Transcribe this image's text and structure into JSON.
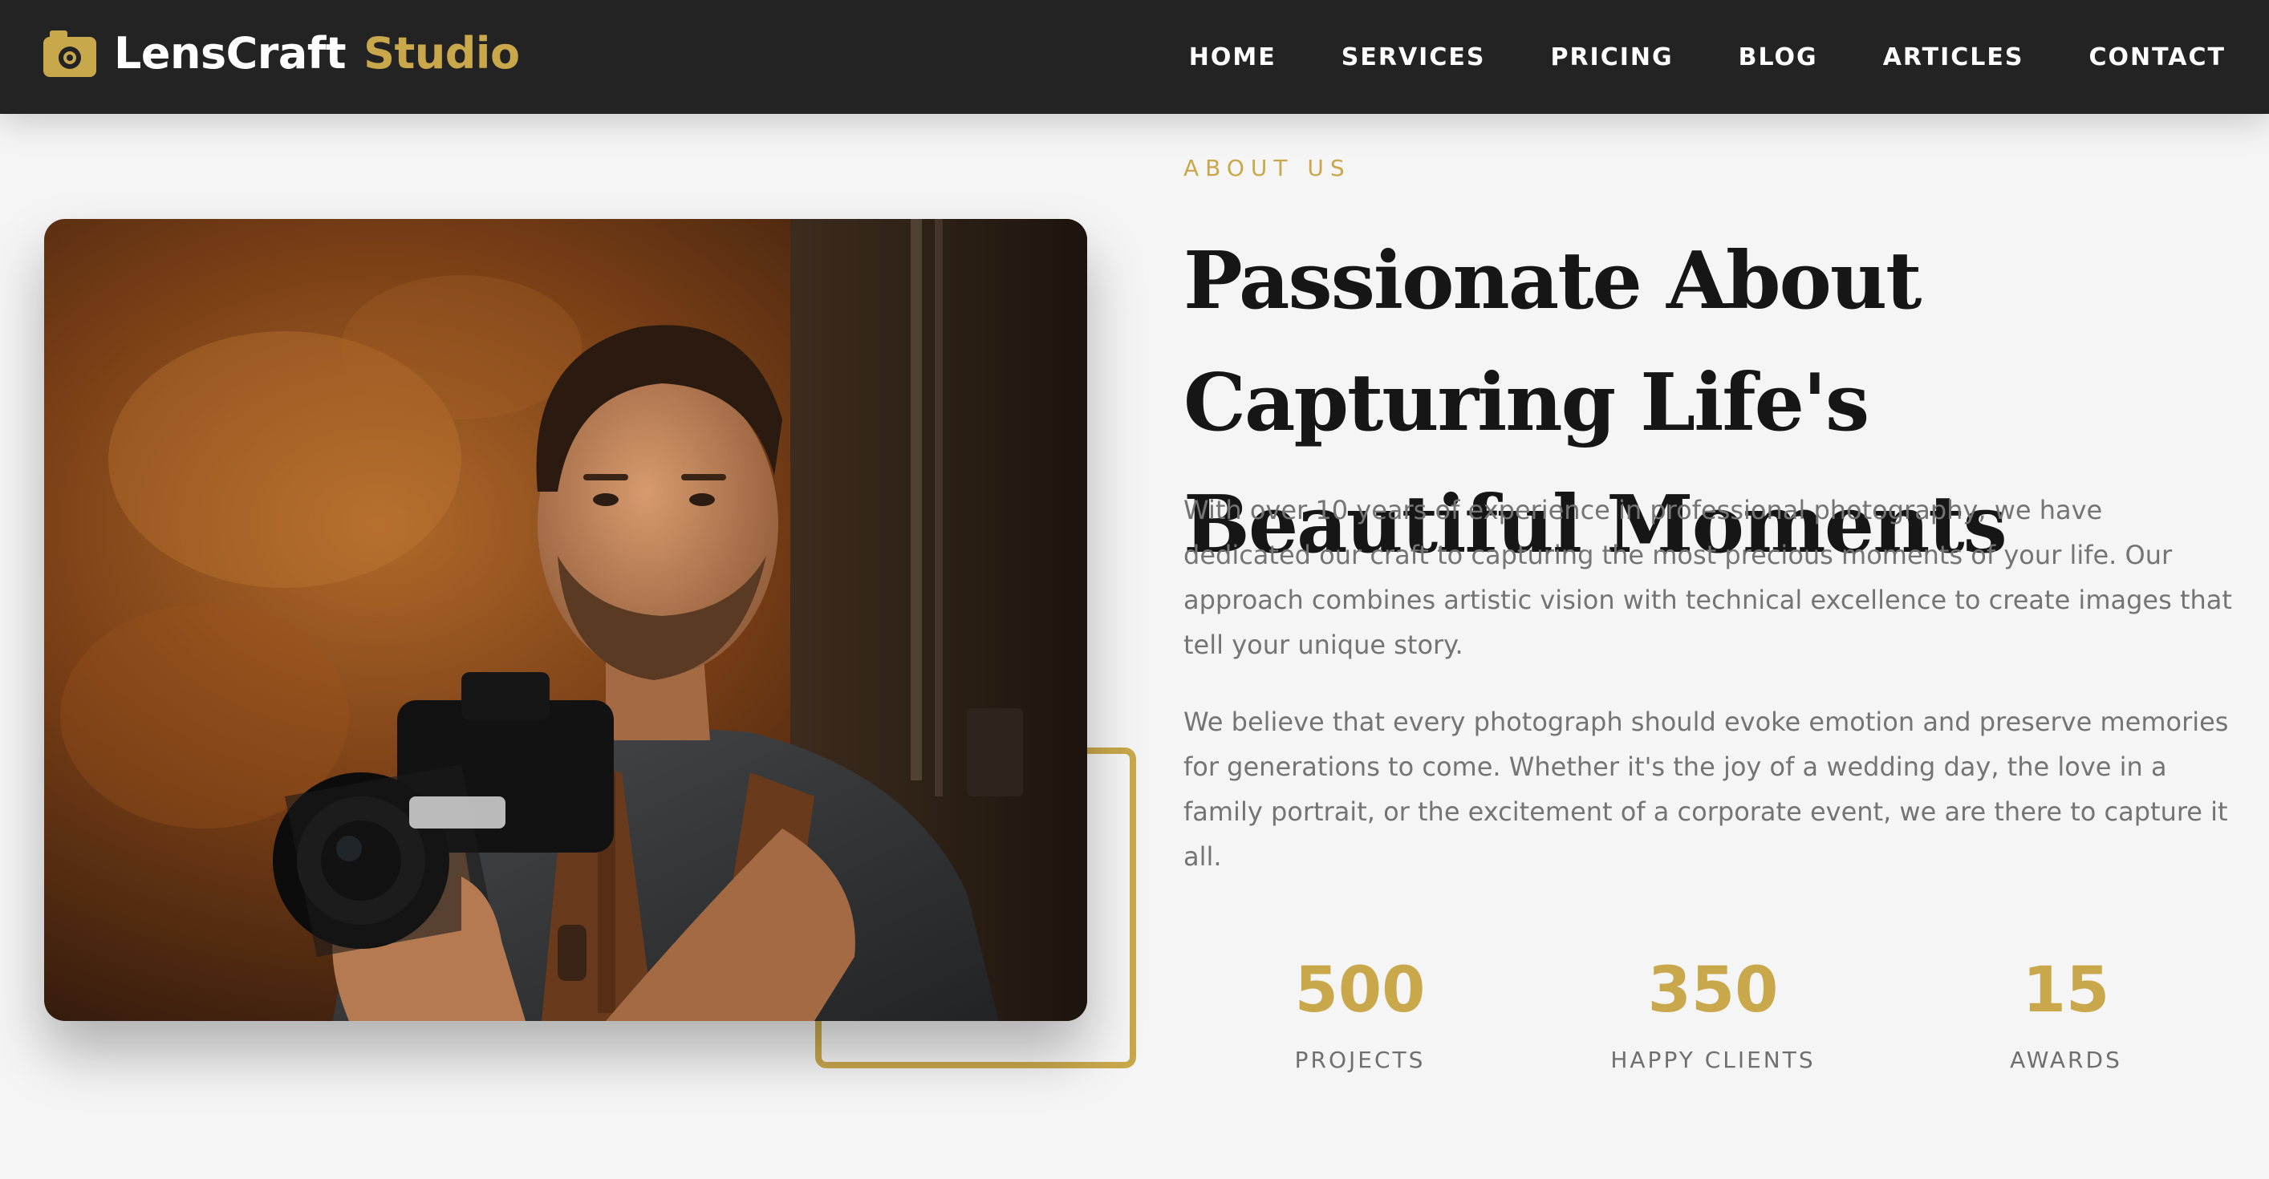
{
  "brand": {
    "name": "LensCraft",
    "accent": "Studio",
    "icon": "camera-icon"
  },
  "nav": {
    "items": [
      {
        "label": "HOME"
      },
      {
        "label": "SERVICES"
      },
      {
        "label": "PRICING"
      },
      {
        "label": "BLOG"
      },
      {
        "label": "ARTICLES"
      },
      {
        "label": "CONTACT"
      }
    ]
  },
  "about": {
    "eyebrow": "ABOUT US",
    "heading": "Passionate About Capturing Life's Beautiful Moments",
    "paragraphs": [
      "With over 10 years of experience in professional photography, we have dedicated our craft to capturing the most precious moments of your life. Our approach combines artistic vision with technical excellence to create images that tell your unique story.",
      "We believe that every photograph should evoke emotion and preserve memories for generations to come. Whether it's the joy of a wedding day, the love in a family portrait, or the excitement of a corporate event, we are there to capture it all."
    ],
    "stats": [
      {
        "value": "500",
        "label": "PROJECTS"
      },
      {
        "value": "350",
        "label": "HAPPY CLIENTS"
      },
      {
        "value": "15",
        "label": "AWARDS"
      }
    ]
  },
  "colors": {
    "accent": "#c9a84c",
    "header_bg": "#232323",
    "page_bg": "#f5f5f5",
    "body_text": "#747474"
  }
}
